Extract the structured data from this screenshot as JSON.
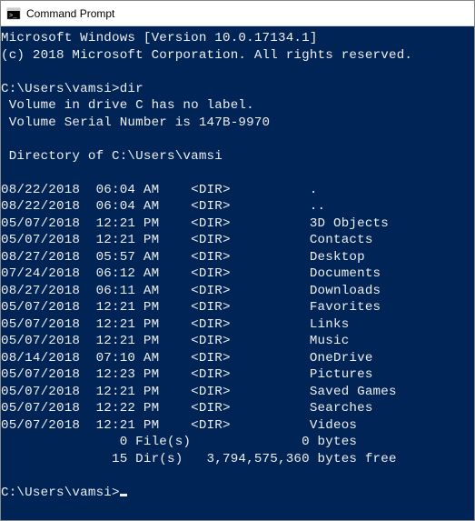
{
  "window": {
    "title": "Command Prompt"
  },
  "terminal": {
    "banner1": "Microsoft Windows [Version 10.0.17134.1]",
    "banner2": "(c) 2018 Microsoft Corporation. All rights reserved.",
    "prompt1": "C:\\Users\\vamsi>",
    "command1": "dir",
    "vol_line": " Volume in drive C has no label.",
    "serial_line": " Volume Serial Number is 147B-9970",
    "dir_of": " Directory of C:\\Users\\vamsi",
    "entries": [
      {
        "date": "08/22/2018",
        "time": "06:04 AM",
        "tag": "<DIR>",
        "name": "."
      },
      {
        "date": "08/22/2018",
        "time": "06:04 AM",
        "tag": "<DIR>",
        "name": ".."
      },
      {
        "date": "05/07/2018",
        "time": "12:21 PM",
        "tag": "<DIR>",
        "name": "3D Objects"
      },
      {
        "date": "05/07/2018",
        "time": "12:21 PM",
        "tag": "<DIR>",
        "name": "Contacts"
      },
      {
        "date": "08/27/2018",
        "time": "05:57 AM",
        "tag": "<DIR>",
        "name": "Desktop"
      },
      {
        "date": "07/24/2018",
        "time": "06:12 AM",
        "tag": "<DIR>",
        "name": "Documents"
      },
      {
        "date": "08/27/2018",
        "time": "06:11 AM",
        "tag": "<DIR>",
        "name": "Downloads"
      },
      {
        "date": "05/07/2018",
        "time": "12:21 PM",
        "tag": "<DIR>",
        "name": "Favorites"
      },
      {
        "date": "05/07/2018",
        "time": "12:21 PM",
        "tag": "<DIR>",
        "name": "Links"
      },
      {
        "date": "05/07/2018",
        "time": "12:21 PM",
        "tag": "<DIR>",
        "name": "Music"
      },
      {
        "date": "08/14/2018",
        "time": "07:10 AM",
        "tag": "<DIR>",
        "name": "OneDrive"
      },
      {
        "date": "05/07/2018",
        "time": "12:23 PM",
        "tag": "<DIR>",
        "name": "Pictures"
      },
      {
        "date": "05/07/2018",
        "time": "12:21 PM",
        "tag": "<DIR>",
        "name": "Saved Games"
      },
      {
        "date": "05/07/2018",
        "time": "12:22 PM",
        "tag": "<DIR>",
        "name": "Searches"
      },
      {
        "date": "05/07/2018",
        "time": "12:21 PM",
        "tag": "<DIR>",
        "name": "Videos"
      }
    ],
    "summary_files": "               0 File(s)              0 bytes",
    "summary_dirs": "              15 Dir(s)   3,794,575,360 bytes free",
    "prompt2": "C:\\Users\\vamsi>"
  }
}
